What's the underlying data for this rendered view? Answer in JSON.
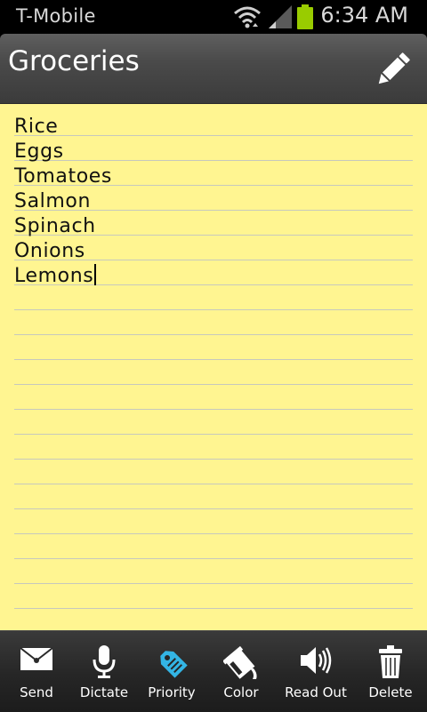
{
  "status_bar": {
    "carrier": "T-Mobile",
    "time": "6:34 AM",
    "icons": [
      "wifi-icon",
      "signal-icon",
      "battery-icon"
    ],
    "battery_color": "#99cc00"
  },
  "header": {
    "title": "Groceries",
    "edit_icon": "pencil-icon"
  },
  "note": {
    "background": "#fff591",
    "items": [
      "Rice",
      "Eggs",
      "Tomatoes",
      "Salmon",
      "Spinach",
      "Onions",
      "Lemons"
    ]
  },
  "toolbar": {
    "items": [
      {
        "label": "Send",
        "icon": "envelope-icon"
      },
      {
        "label": "Dictate",
        "icon": "microphone-icon"
      },
      {
        "label": "Priority",
        "icon": "tag-icon",
        "color": "#33b5e5"
      },
      {
        "label": "Color",
        "icon": "paint-bucket-icon"
      },
      {
        "label": "Read Out",
        "icon": "speaker-icon"
      },
      {
        "label": "Delete",
        "icon": "trash-icon"
      }
    ]
  }
}
